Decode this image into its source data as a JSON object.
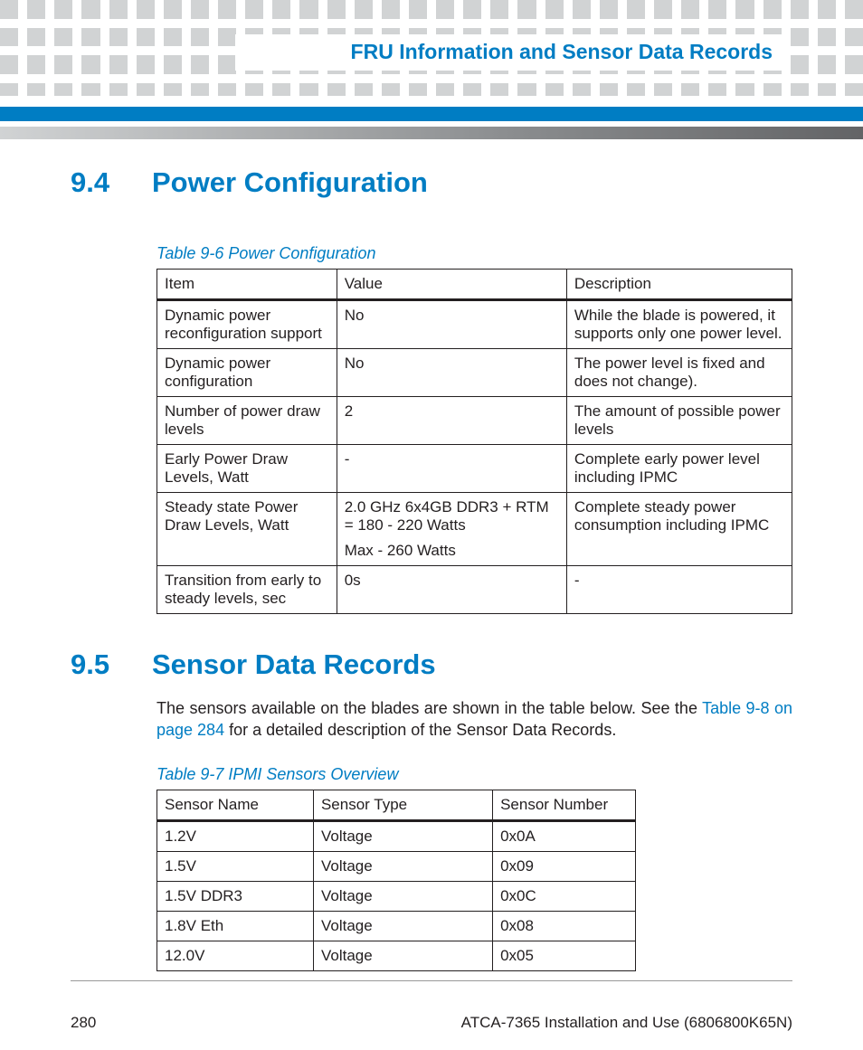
{
  "header": {
    "running_title": "FRU Information and Sensor Data Records"
  },
  "sections": {
    "s1": {
      "number": "9.4",
      "title": "Power Configuration",
      "table_caption": "Table 9-6 Power Configuration",
      "table_headers": [
        "Item",
        "Value",
        "Description"
      ],
      "rows": [
        [
          "Dynamic power reconfiguration support",
          "No",
          "While the blade is powered, it supports only one power level."
        ],
        [
          "Dynamic power configuration",
          "No",
          "The power level is fixed and does not change)."
        ],
        [
          "Number of power draw levels",
          "2",
          "The amount of possible power levels"
        ],
        [
          "Early Power Draw Levels, Watt",
          "-",
          "Complete early power level including IPMC"
        ],
        [
          "Steady state Power Draw Levels, Watt",
          "2.0 GHz 6x4GB DDR3 + RTM = 180 - 220 Watts\nMax - 260 Watts",
          "Complete steady power consumption including IPMC"
        ],
        [
          "Transition from early to steady levels, sec",
          "0s",
          "-"
        ]
      ]
    },
    "s2": {
      "number": "9.5",
      "title": "Sensor Data Records",
      "para_pre": "The sensors available on the blades are shown in the table below. See the ",
      "link_text": "Table 9-8 on page 284",
      "para_post": " for a detailed description of the Sensor Data Records.",
      "table_caption": "Table 9-7 IPMI Sensors Overview",
      "table_headers": [
        "Sensor Name",
        "Sensor Type",
        "Sensor Number"
      ],
      "rows": [
        [
          "1.2V",
          "Voltage",
          "0x0A"
        ],
        [
          "1.5V",
          "Voltage",
          "0x09"
        ],
        [
          "1.5V DDR3",
          "Voltage",
          "0x0C"
        ],
        [
          "1.8V Eth",
          "Voltage",
          "0x08"
        ],
        [
          "12.0V",
          "Voltage",
          "0x05"
        ]
      ]
    }
  },
  "footer": {
    "page_number": "280",
    "doc_id": "ATCA-7365 Installation and Use (6806800K65N)"
  },
  "chart_data": [
    {
      "type": "table",
      "title": "Table 9-6 Power Configuration",
      "columns": [
        "Item",
        "Value",
        "Description"
      ],
      "rows": [
        [
          "Dynamic power reconfiguration support",
          "No",
          "While the blade is powered, it supports only one power level."
        ],
        [
          "Dynamic power configuration",
          "No",
          "The power level is fixed and does not change)."
        ],
        [
          "Number of power draw levels",
          "2",
          "The amount of possible power levels"
        ],
        [
          "Early Power Draw Levels, Watt",
          "-",
          "Complete early power level including IPMC"
        ],
        [
          "Steady state Power Draw Levels, Watt",
          "2.0 GHz 6x4GB DDR3 + RTM = 180 - 220 Watts; Max - 260 Watts",
          "Complete steady power consumption including IPMC"
        ],
        [
          "Transition from early to steady levels, sec",
          "0s",
          "-"
        ]
      ]
    },
    {
      "type": "table",
      "title": "Table 9-7 IPMI Sensors Overview",
      "columns": [
        "Sensor Name",
        "Sensor Type",
        "Sensor Number"
      ],
      "rows": [
        [
          "1.2V",
          "Voltage",
          "0x0A"
        ],
        [
          "1.5V",
          "Voltage",
          "0x09"
        ],
        [
          "1.5V DDR3",
          "Voltage",
          "0x0C"
        ],
        [
          "1.8V Eth",
          "Voltage",
          "0x08"
        ],
        [
          "12.0V",
          "Voltage",
          "0x05"
        ]
      ]
    }
  ]
}
